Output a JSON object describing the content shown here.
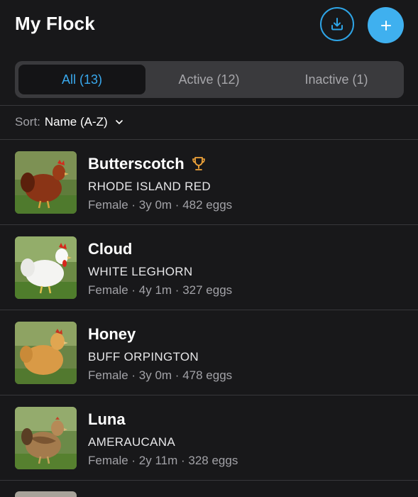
{
  "header": {
    "title": "My Flock"
  },
  "tabs": [
    {
      "label": "All (13)",
      "selected": true
    },
    {
      "label": "Active (12)",
      "selected": false
    },
    {
      "label": "Inactive (1)",
      "selected": false
    }
  ],
  "sort": {
    "label": "Sort:",
    "value": "Name (A-Z)"
  },
  "colors": {
    "accent": "#3fb0ef",
    "trophy": "#f0a43a",
    "background": "#18181a"
  },
  "chickens": [
    {
      "name": "Butterscotch",
      "breed": "RHODE ISLAND RED",
      "meta": "Female · 3y 0m · 482 eggs",
      "badge": "trophy-icon"
    },
    {
      "name": "Cloud",
      "breed": "WHITE LEGHORN",
      "meta": "Female · 4y 1m · 327 eggs"
    },
    {
      "name": "Honey",
      "breed": "BUFF ORPINGTON",
      "meta": "Female · 3y 0m · 478 eggs"
    },
    {
      "name": "Luna",
      "breed": "AMERAUCANA",
      "meta": "Female · 2y 11m · 328 eggs"
    }
  ]
}
